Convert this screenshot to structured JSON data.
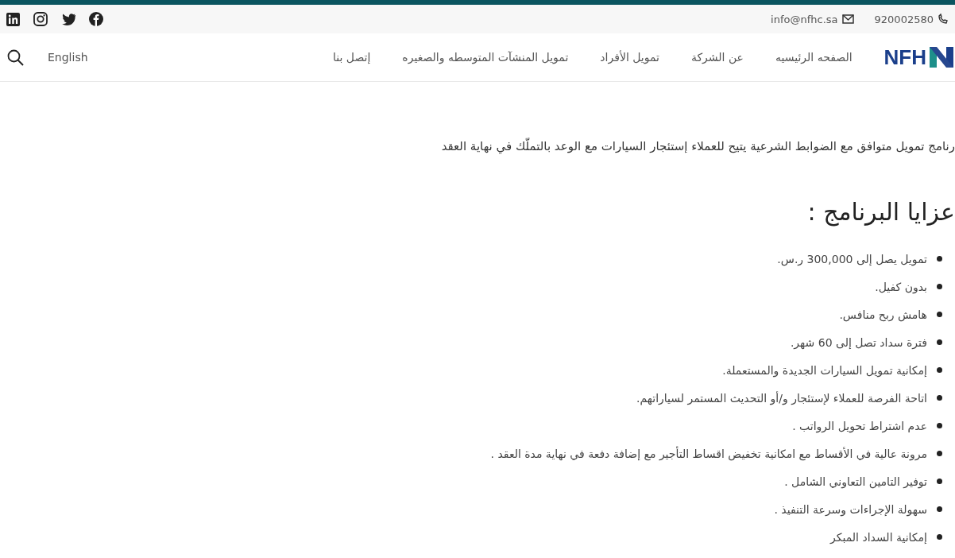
{
  "topbar": {
    "phone": "920002580",
    "email": "info@nfhc.sa"
  },
  "logo": {
    "text": "NFH"
  },
  "nav": {
    "items": [
      {
        "label": "الصفحه الرئيسيه"
      },
      {
        "label": "عن الشركة"
      },
      {
        "label": "تمويل الأفراد"
      },
      {
        "label": "تمويل المنشآت المتوسطه والصغيره"
      },
      {
        "label": "إتصل بنا"
      }
    ],
    "language": "English"
  },
  "intro": "رنامج تمويل متوافق مع الضوابط الشرعية يتيح للعملاء إستئجار السيارات مع الوعد بالتملّك في نهاية العقد",
  "heading": "عزايا البرنامج :",
  "features": [
    "تمويل يصل إلى 300,000 ر.س.",
    "بدون كفيل.",
    "هامش ربح منافس.",
    "فترة سداد تصل إلى 60 شهر.",
    "إمكانية تمويل السيارات الجديدة والمستعملة.",
    "اتاحة الفرصة للعملاء لإستئجار و/أو التحديث المستمر لسياراتهم.",
    "عدم اشتراط تحويل الرواتب .",
    "مرونة عالية في الأقساط مع امكانية تخفيض اقساط التأجير مع إضافة دفعة في نهاية مدة العقد .",
    "توفير التامين التعاوني الشامل .",
    "سهولة الإجراءات وسرعة التنفيذ .",
    "إمكانية السداد المبكر"
  ]
}
